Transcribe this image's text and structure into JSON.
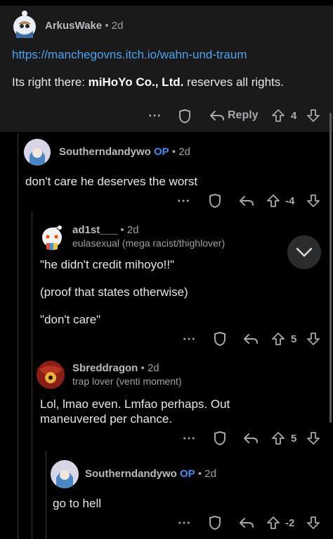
{
  "comments": [
    {
      "username": "ArkusWake",
      "age": "2d",
      "link": "https://manchegovns.itch.io/wahn-und-traum",
      "text_pre": "Its right there:  ",
      "text_bold": "miHoYo Co., Ltd.",
      "text_post": " reserves all rights.",
      "reply_label": "Reply",
      "score": "4"
    },
    {
      "username": "Southerndandywo",
      "op": "OP",
      "age": "2d",
      "text": "don't care he deserves the worst",
      "score": "-4"
    },
    {
      "username": "ad1st___",
      "age": "2d",
      "flair": "eulasexual (mega racist/thighlover)",
      "lines": [
        "\"he didn't credit mihoyo!!\"",
        "(proof that states otherwise)",
        "\"don't care\""
      ],
      "score": "5"
    },
    {
      "username": "Sbreddragon",
      "age": "2d",
      "flair": "trap lover (venti moment)",
      "text": "Lol, lmao even. Lmfao perhaps. Out maneuvered per chance.",
      "score": "5"
    },
    {
      "username": "Southerndandywo",
      "op": "OP",
      "age": "2d",
      "text": "go to hell",
      "score": "-2"
    }
  ],
  "icons": {
    "more": "more-icon",
    "award": "award-shield-icon",
    "reply": "reply-arrow-icon",
    "upvote": "upvote-arrow-icon",
    "downvote": "downvote-arrow-icon",
    "collapse": "chevron-down-icon"
  },
  "colors": {
    "op": "#3d8df5",
    "link": "#4aa3f0",
    "top_block": "#1a1a1b",
    "background": "#000000"
  }
}
